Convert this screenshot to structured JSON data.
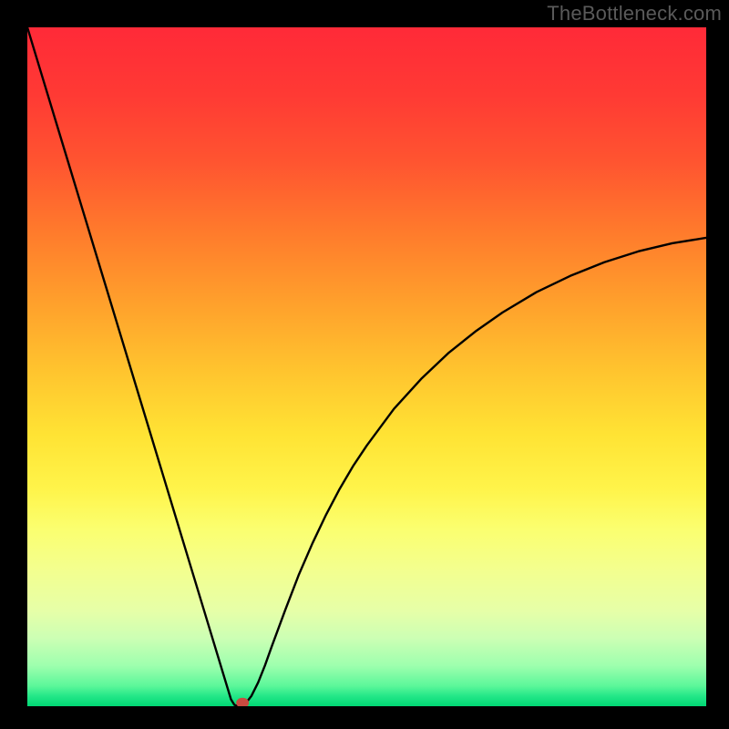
{
  "watermark": "TheBottleneck.com",
  "chart_data": {
    "type": "line",
    "title": "",
    "xlabel": "",
    "ylabel": "",
    "xlim": [
      0,
      100
    ],
    "ylim": [
      0,
      100
    ],
    "curve_x": [
      0,
      2,
      4,
      6,
      8,
      10,
      12,
      14,
      16,
      18,
      20,
      22,
      24,
      26,
      28,
      29,
      30,
      30.5,
      31,
      31.5,
      32,
      33,
      34,
      35,
      36,
      38,
      40,
      42,
      44,
      46,
      48,
      50,
      54,
      58,
      62,
      66,
      70,
      75,
      80,
      85,
      90,
      95,
      100
    ],
    "curve_y": [
      100,
      93.4,
      86.8,
      80.2,
      73.6,
      67.0,
      60.4,
      53.8,
      47.2,
      40.6,
      34.0,
      27.4,
      20.8,
      14.2,
      7.6,
      4.3,
      1.0,
      0.2,
      0.0,
      0.0,
      0.2,
      1.5,
      3.5,
      6.0,
      8.8,
      14.2,
      19.4,
      24.0,
      28.2,
      32.0,
      35.4,
      38.4,
      43.8,
      48.2,
      52.0,
      55.2,
      58.0,
      61.0,
      63.4,
      65.4,
      67.0,
      68.2,
      69.0
    ],
    "marker": {
      "x": 31.7,
      "y": 0.5,
      "color": "#c94a40"
    },
    "gradient_stops": [
      {
        "offset": 0.0,
        "color": "#ff2a38"
      },
      {
        "offset": 0.1,
        "color": "#ff3a34"
      },
      {
        "offset": 0.2,
        "color": "#ff5530"
      },
      {
        "offset": 0.3,
        "color": "#ff7a2c"
      },
      {
        "offset": 0.4,
        "color": "#ff9e2c"
      },
      {
        "offset": 0.5,
        "color": "#ffc22e"
      },
      {
        "offset": 0.6,
        "color": "#ffe334"
      },
      {
        "offset": 0.68,
        "color": "#fff44a"
      },
      {
        "offset": 0.74,
        "color": "#fbff70"
      },
      {
        "offset": 0.8,
        "color": "#f3ff8f"
      },
      {
        "offset": 0.86,
        "color": "#e6ffa8"
      },
      {
        "offset": 0.9,
        "color": "#ccffb4"
      },
      {
        "offset": 0.94,
        "color": "#9effae"
      },
      {
        "offset": 0.97,
        "color": "#5cf79a"
      },
      {
        "offset": 0.985,
        "color": "#24e788"
      },
      {
        "offset": 1.0,
        "color": "#00d774"
      }
    ]
  }
}
